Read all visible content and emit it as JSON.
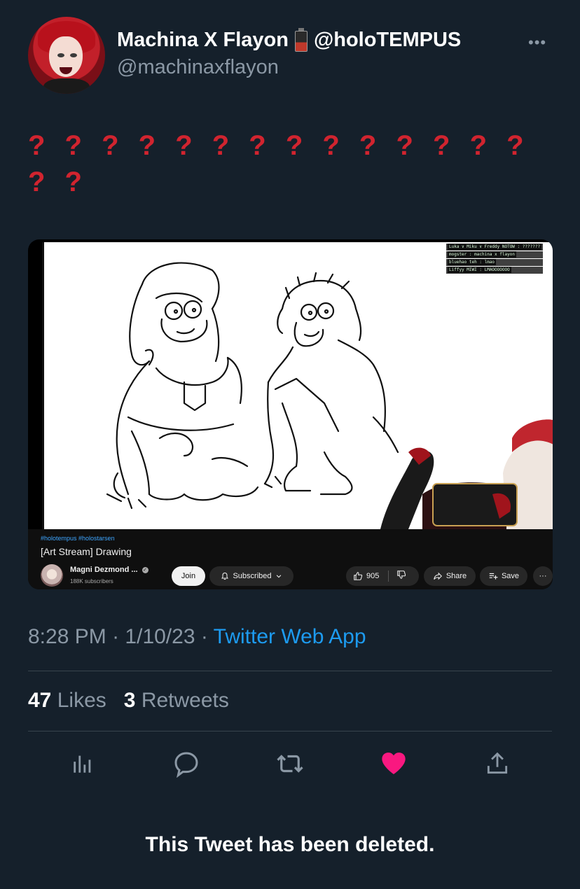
{
  "user": {
    "display_name": "Machina X Flayon",
    "affiliation": "@holoTEMPUS",
    "handle": "@machinaxflayon",
    "badge_icon": "battery-icon"
  },
  "tweet": {
    "text_line1": "? ? ? ? ? ? ? ? ? ? ? ? ? ?",
    "text_line2": "? ?",
    "text_color": "#d1242f"
  },
  "media": {
    "chat": [
      {
        "user": "Luka ∨ Miku ∨ Freddy NOTOW",
        "msg": "???????"
      },
      {
        "user": "mogster",
        "msg": "machina x flayon"
      },
      {
        "user": "bluehao teh",
        "msg": "lmao"
      },
      {
        "user": "Liffyy MIWI",
        "msg": "LMAOOOOOOO"
      }
    ],
    "tags": "#holotempus #holostarsen",
    "video_title": "[Art Stream] Drawing",
    "channel_name": "Magni Dezmond ...",
    "subscribers": "188K subscribers",
    "join_label": "Join",
    "subscribed_label": "Subscribed",
    "likes": "905",
    "share_label": "Share",
    "save_label": "Save"
  },
  "meta": {
    "time": "8:28 PM",
    "date": "1/10/23",
    "sep": "·",
    "app": "Twitter Web App"
  },
  "stats": {
    "likes_count": "47",
    "likes_label": "Likes",
    "retweets_count": "3",
    "retweets_label": "Retweets"
  },
  "actions": [
    "analytics-icon",
    "reply-icon",
    "retweet-icon",
    "like-icon",
    "share-icon"
  ],
  "colors": {
    "background": "#15202b",
    "accent": "#1d9bf0",
    "like_active": "#f91880",
    "muted": "#8b98a5"
  },
  "footer": {
    "notice": "This Tweet has been deleted."
  }
}
